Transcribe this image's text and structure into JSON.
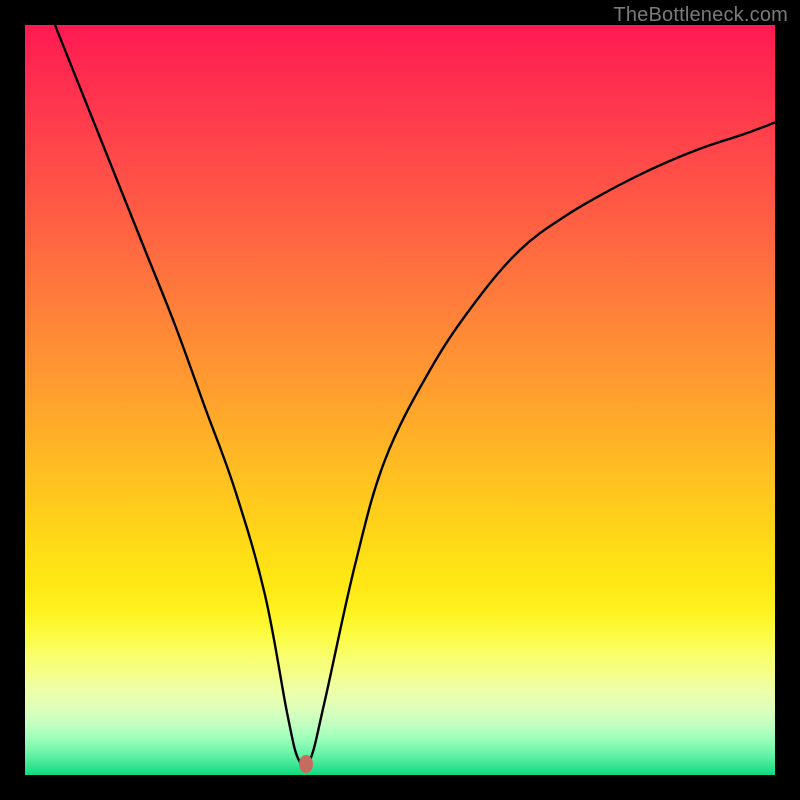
{
  "watermark": "TheBottleneck.com",
  "chart_data": {
    "type": "line",
    "title": "",
    "xlabel": "",
    "ylabel": "",
    "xlim": [
      0,
      100
    ],
    "ylim": [
      0,
      100
    ],
    "grid": false,
    "legend": false,
    "series": [
      {
        "name": "bottleneck-curve",
        "x": [
          4,
          8,
          12,
          16,
          20,
          24,
          28,
          32,
          35,
          36.5,
          38,
          40,
          44,
          48,
          54,
          60,
          66,
          72,
          78,
          84,
          90,
          96,
          100
        ],
        "y": [
          100,
          90,
          80,
          70,
          60,
          49,
          38,
          24,
          8,
          2,
          2,
          10,
          28,
          42,
          54,
          63,
          70,
          74.5,
          78,
          81,
          83.5,
          85.5,
          87
        ],
        "color": "#000000"
      }
    ],
    "annotations": [
      {
        "name": "optimum-marker",
        "x": 37.5,
        "y": 1.5,
        "color": "#c66b60"
      }
    ],
    "background_gradient": {
      "type": "vertical",
      "stops": [
        {
          "pos": 0.0,
          "color": "#ff1a52"
        },
        {
          "pos": 0.05,
          "color": "#ff2850"
        },
        {
          "pos": 0.1,
          "color": "#ff354e"
        },
        {
          "pos": 0.15,
          "color": "#ff424b"
        },
        {
          "pos": 0.2,
          "color": "#ff4f48"
        },
        {
          "pos": 0.25,
          "color": "#ff5c44"
        },
        {
          "pos": 0.3,
          "color": "#ff6a40"
        },
        {
          "pos": 0.35,
          "color": "#ff783c"
        },
        {
          "pos": 0.4,
          "color": "#ff8637"
        },
        {
          "pos": 0.45,
          "color": "#ff9432"
        },
        {
          "pos": 0.5,
          "color": "#ffa22d"
        },
        {
          "pos": 0.55,
          "color": "#ffb127"
        },
        {
          "pos": 0.6,
          "color": "#ffc021"
        },
        {
          "pos": 0.65,
          "color": "#ffce1b"
        },
        {
          "pos": 0.7,
          "color": "#ffdd16"
        },
        {
          "pos": 0.75,
          "color": "#ffe915"
        },
        {
          "pos": 0.78,
          "color": "#fff21f"
        },
        {
          "pos": 0.8,
          "color": "#fdf833"
        },
        {
          "pos": 0.82,
          "color": "#fbfc4d"
        },
        {
          "pos": 0.84,
          "color": "#f9ff6b"
        },
        {
          "pos": 0.86,
          "color": "#f6ff84"
        },
        {
          "pos": 0.875,
          "color": "#f2ff99"
        },
        {
          "pos": 0.89,
          "color": "#ecffab"
        },
        {
          "pos": 0.905,
          "color": "#e2ffb6"
        },
        {
          "pos": 0.92,
          "color": "#d3ffbe"
        },
        {
          "pos": 0.935,
          "color": "#bcffc0"
        },
        {
          "pos": 0.95,
          "color": "#9effba"
        },
        {
          "pos": 0.965,
          "color": "#79f7ae"
        },
        {
          "pos": 0.98,
          "color": "#4eec9d"
        },
        {
          "pos": 0.99,
          "color": "#2ee28e"
        },
        {
          "pos": 1.0,
          "color": "#09d97e"
        }
      ]
    }
  }
}
